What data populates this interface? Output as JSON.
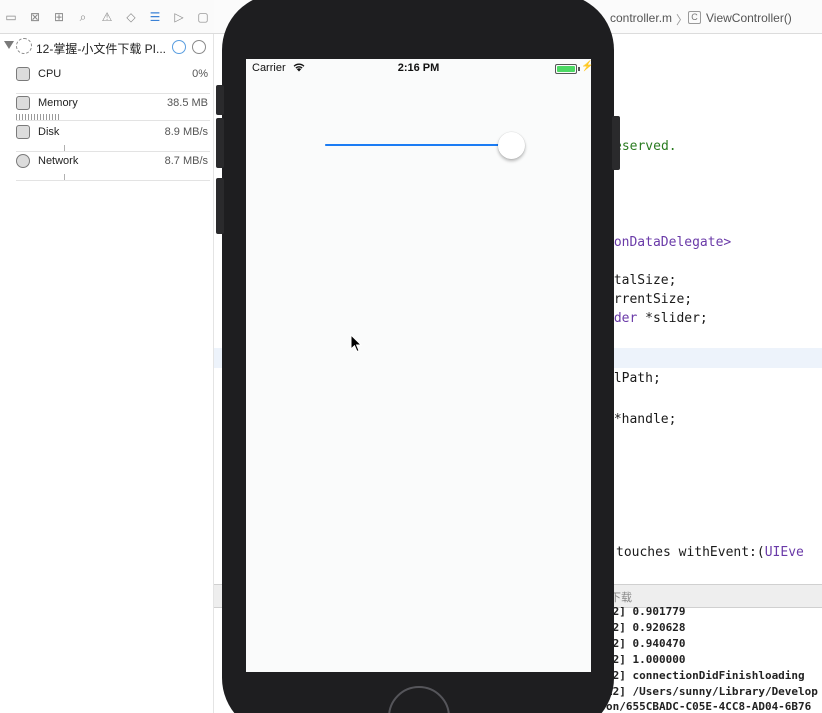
{
  "navigator": {
    "toolbar_icons": [
      "folder-icon",
      "symbol-icon",
      "hierarchy-icon",
      "search-icon",
      "warning-icon",
      "test-icon",
      "debug-icon",
      "breakpoint-icon",
      "report-icon"
    ],
    "process_name": "12-掌握-小文件下载 PI...",
    "gauges": {
      "cpu": {
        "label": "CPU",
        "value": "0%"
      },
      "memory": {
        "label": "Memory",
        "value": "38.5 MB"
      },
      "disk": {
        "label": "Disk",
        "value": "8.9 MB/s"
      },
      "network": {
        "label": "Network",
        "value": "8.7 MB/s"
      }
    }
  },
  "editor": {
    "jump_bar": {
      "file": "controller.m",
      "separator": "〉",
      "class_icon": "C",
      "function": "ViewController()"
    },
    "code": {
      "reserved": "eserved.",
      "delegate": "ionDataDelegate>",
      "total": "otalSize;",
      "current": "urrentSize;",
      "slider_type": "ider",
      "slider_var": " *slider;",
      "path": "llPath;",
      "handle": " *handle;",
      "touches_prefix": "touches withEvent:(",
      "touches_type": "UIEve"
    },
    "debug_title": "下载",
    "console_lines": [
      "12] 0.901779",
      "12] 0.920628",
      "12] 0.940470",
      "12] 1.000000",
      "12] connectionDidFinishloading",
      "12] /Users/sunny/Library/Develop",
      "on/655CBADC-C05E-4CC8-AD04-6B76"
    ]
  },
  "simulator": {
    "carrier": "Carrier",
    "time": "2:16 PM",
    "slider_value": 1.0,
    "colors": {
      "slider_min_track": "#1b7cf4",
      "battery": "#4cd964"
    }
  }
}
